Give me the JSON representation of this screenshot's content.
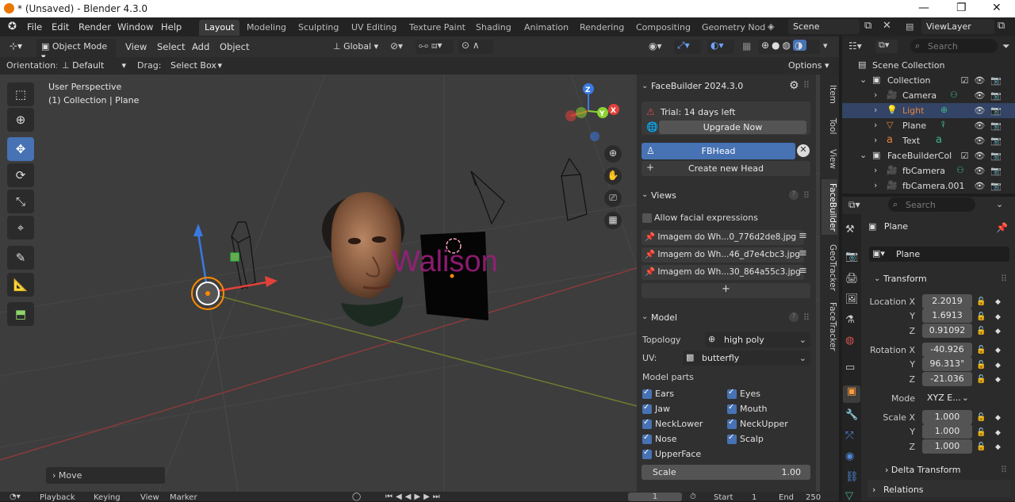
{
  "window": {
    "title": "* (Unsaved) - Blender 4.3.0",
    "minimize": "—",
    "maximize": "❐",
    "close": "✕"
  },
  "menu": [
    "File",
    "Edit",
    "Render",
    "Window",
    "Help"
  ],
  "workspaces": [
    "Layout",
    "Modeling",
    "Sculpting",
    "UV Editing",
    "Texture Paint",
    "Shading",
    "Animation",
    "Rendering",
    "Compositing",
    "Geometry Nod"
  ],
  "active_workspace": "Layout",
  "scene": "Scene",
  "view_layer": "ViewLayer",
  "viewport_header": {
    "mode": "Object Mode",
    "menus": [
      "View",
      "Select",
      "Add",
      "Object"
    ],
    "transform": "Global"
  },
  "viewport_header2": {
    "orientation_label": "Orientation:",
    "orientation_value": "Default",
    "drag_label": "Drag:",
    "drag_value": "Select Box",
    "options": "Options"
  },
  "viewport": {
    "perspective": "User Perspective",
    "context": "(1) Collection | Plane",
    "scene_text": "Walison",
    "last_op": "Move"
  },
  "nav_gizmo": {
    "z": "Z",
    "y": "Y",
    "x": "X"
  },
  "npanel_tabs": [
    "Item",
    "Tool",
    "View",
    "FaceBuilder",
    "GeoTracker",
    "FaceTracker"
  ],
  "facebuilder": {
    "header": "FaceBuilder 2024.3.0",
    "trial": "Trial: 14 days left",
    "upgrade": "Upgrade Now",
    "head": "FBHead",
    "create_head": "Create new Head",
    "views_title": "Views",
    "allow_expr": "Allow facial expressions",
    "images": [
      "Imagem do Wh...0_776d2de8.jpg",
      "Imagem do Wh...46_d7e4cbc3.jpg",
      "Imagem do Wh...30_864a55c3.jpg"
    ],
    "add": "+",
    "model_title": "Model",
    "topology_label": "Topology",
    "topology": "high poly",
    "uv_label": "UV:",
    "uv": "butterfly",
    "parts_label": "Model parts",
    "parts": [
      "Ears",
      "Eyes",
      "Jaw",
      "Mouth",
      "NeckLower",
      "NeckUpper",
      "Nose",
      "Scalp",
      "UpperFace"
    ],
    "scale_label": "Scale",
    "scale": "1.00"
  },
  "outliner": {
    "search": "Search",
    "rows": [
      {
        "name": "Scene Collection",
        "level": 0
      },
      {
        "name": "Collection",
        "level": 1
      },
      {
        "name": "Camera",
        "level": 2
      },
      {
        "name": "Light",
        "level": 2
      },
      {
        "name": "Plane",
        "level": 2
      },
      {
        "name": "Text",
        "level": 2
      },
      {
        "name": "FaceBuilderCol",
        "level": 1
      },
      {
        "name": "fbCamera",
        "level": 2
      },
      {
        "name": "fbCamera.001",
        "level": 2
      }
    ]
  },
  "properties": {
    "search": "Search",
    "object": "Plane",
    "name_field": "Plane",
    "transform_title": "Transform",
    "location": {
      "label": "Location X",
      "x": "2.2019",
      "y": "1.6913",
      "z": "0.91092"
    },
    "rotation": {
      "label": "Rotation X",
      "x": "-40.926",
      "y": "96.313°",
      "z": "-21.036"
    },
    "mode_label": "Mode",
    "mode": "XYZ E...",
    "scale": {
      "label": "Scale X",
      "x": "1.000",
      "y": "1.000",
      "z": "1.000"
    },
    "axis_y": "Y",
    "axis_z": "Z",
    "delta": "Delta Transform",
    "relations": "Relations"
  },
  "timeline": {
    "menus": [
      "Playback",
      "Keying",
      "View",
      "Marker"
    ],
    "frame": "1",
    "start_label": "Start",
    "start": "1",
    "end_label": "End",
    "end": "250"
  },
  "colors": {
    "accent": "#4772b3",
    "x_axis": "#e2413b",
    "y_axis": "#8bd232",
    "z_axis": "#3a79e2",
    "origin": "#ff8a00",
    "text_3d": "#9a1e7a"
  }
}
